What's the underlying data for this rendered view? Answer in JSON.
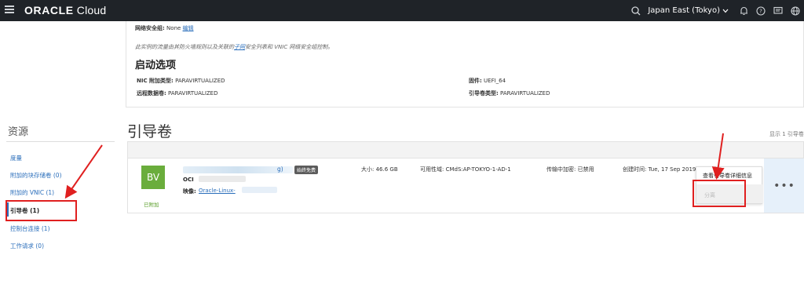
{
  "topbar": {
    "logo_brand": "ORACLE",
    "logo_product": " Cloud",
    "region": "Japan East (Tokyo)"
  },
  "top_section": {
    "nsg_label": "网络安全组:",
    "nsg_value": "None",
    "nsg_edit": "编辑",
    "traffic_note_pre": "此实例的流量由其防火墙规则以及关联的",
    "traffic_note_link": "子网",
    "traffic_note_post": "安全列表和 VNIC 网络安全组控制。",
    "launch_title": "启动选项",
    "nic_label": "NIC 附加类型:",
    "nic_value": "PARAVIRTUALIZED",
    "remote_label": "远程数据卷:",
    "remote_value": "PARAVIRTUALIZED",
    "firmware_label": "固件:",
    "firmware_value": "UEFI_64",
    "boot_type_label": "引导卷类型:",
    "boot_type_value": "PARAVIRTUALIZED"
  },
  "sidebar": {
    "title": "资源",
    "items": [
      {
        "label": "度量"
      },
      {
        "label": "附加的块存储卷 (0)"
      },
      {
        "label": "附加的 VNIC (1)"
      },
      {
        "label": "引导卷 (1)"
      },
      {
        "label": "控制台连接 (1)"
      },
      {
        "label": "工作请求 (0)"
      }
    ]
  },
  "boot_volume": {
    "title": "引导卷",
    "show_count": "显示 1 引导卷",
    "row": {
      "icon_text": "BV",
      "status": "已附加",
      "name_tail": "g)",
      "tag": "始终免费",
      "ocid_label": "OCI",
      "image_label": "映像:",
      "image_value": "Oracle-Linux-",
      "size": "大小: 46.6 GB",
      "availability": "可用性域: CMdS:AP-TOKYO-1-AD-1",
      "transit_enc": "传输中加密: 已禁用",
      "created": "创建时间: Tue, 17 Sep 2019"
    },
    "menu": {
      "view_details": "查看引导卷详细信息",
      "detach": "分离"
    },
    "kebab": "•••"
  },
  "colors": {
    "topbar": "#1f2328",
    "link": "#2a6ebb",
    "bv_green": "#6aad3c",
    "annotation_red": "#e02020"
  }
}
